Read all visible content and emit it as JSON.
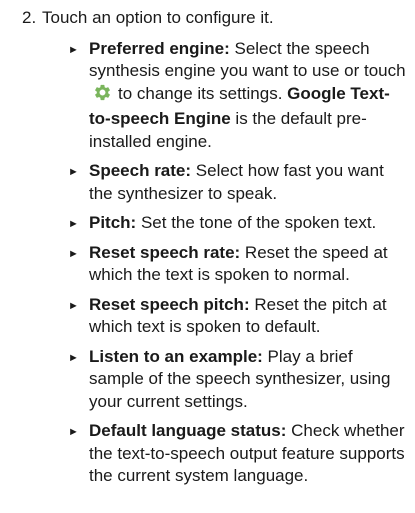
{
  "step": {
    "number": "2.",
    "text": "Touch an option to configure it."
  },
  "bullet_marker": "►",
  "items": [
    {
      "term": "Preferred engine:",
      "text_before_icon": " Select the speech synthesis engine you want to use or touch",
      "icon": "gear-icon",
      "icon_color": "#7ab55c",
      "text_after_icon": "to change its settings. ",
      "emphasis": "Google Text-to-speech Engine",
      "text_end": " is the default pre-installed engine."
    },
    {
      "term": "Speech rate:",
      "text": " Select how fast you want the synthesizer to speak."
    },
    {
      "term": "Pitch:",
      "text": " Set the tone of the spoken text."
    },
    {
      "term": "Reset speech rate:",
      "text": " Reset the speed at which the text is spoken to normal."
    },
    {
      "term": "Reset speech pitch:",
      "text": " Reset the pitch at which text is spoken to default."
    },
    {
      "term": "Listen to an example:",
      "text": " Play a brief sample of the speech synthesizer, using your current settings."
    },
    {
      "term": "Default language status:",
      "text": " Check whether the text-to-speech output feature supports the current system language."
    }
  ]
}
